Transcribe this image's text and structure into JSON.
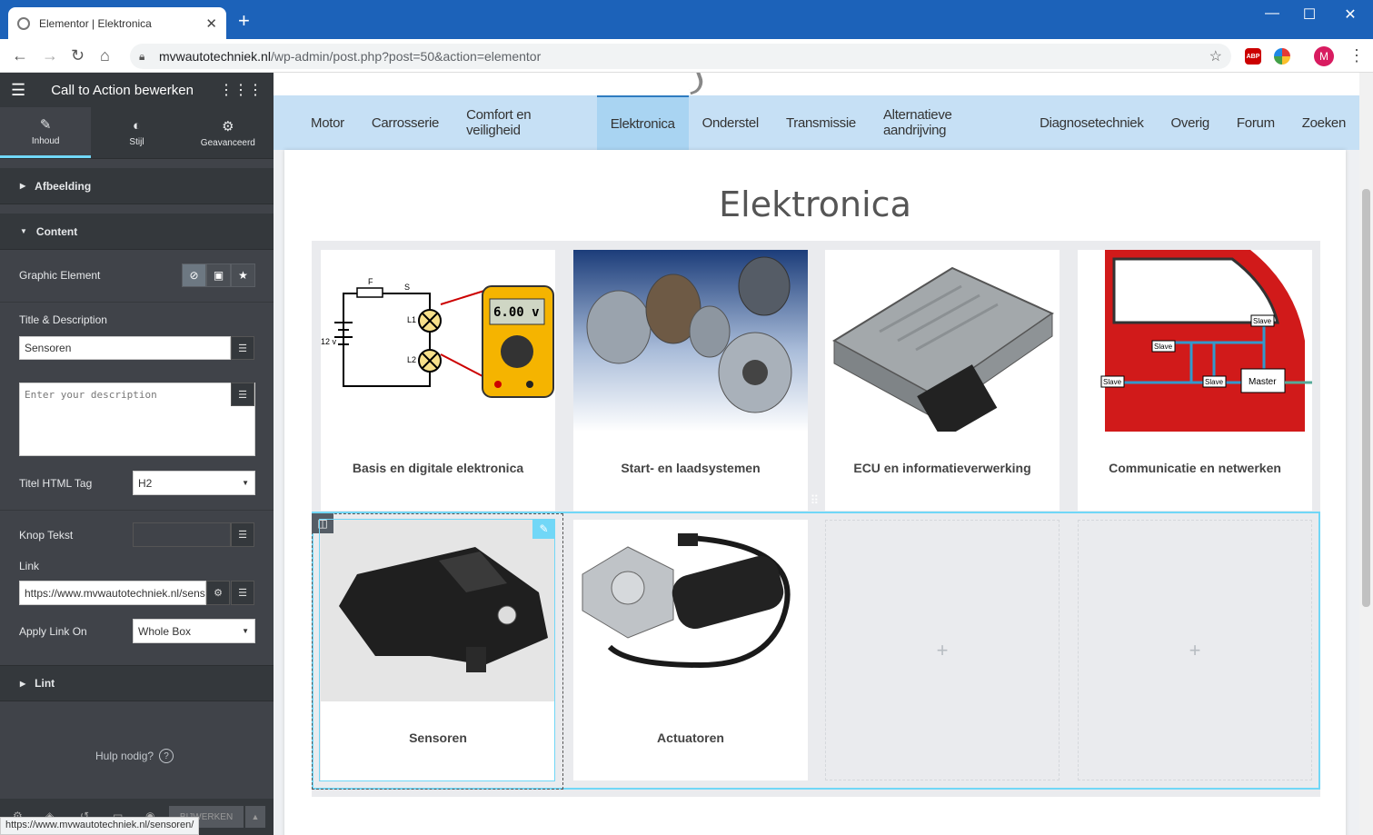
{
  "browser": {
    "tab_title": "Elementor | Elektronica",
    "new_tab": "+",
    "url_domain": "mvwautotechniek.nl",
    "url_path": "/wp-admin/post.php?post=50&action=elementor",
    "avatar_letter": "M",
    "status_url": "https://www.mvwautotechniek.nl/sensoren/",
    "ext_abp": "ABP"
  },
  "panel": {
    "title": "Call to Action bewerken",
    "tabs": [
      {
        "label": "Inhoud",
        "icon": "pencil-icon"
      },
      {
        "label": "Stijl",
        "icon": "contrast-icon"
      },
      {
        "label": "Geavanceerd",
        "icon": "gear-icon"
      }
    ],
    "sections": {
      "afbeelding": "Afbeelding",
      "content": "Content",
      "lint": "Lint"
    },
    "controls": {
      "graphic_element": "Graphic Element",
      "title_desc": "Title & Description",
      "title_value": "Sensoren",
      "desc_placeholder": "Enter your description",
      "html_tag_label": "Titel HTML Tag",
      "html_tag_value": "H2",
      "button_text_label": "Knop Tekst",
      "button_text_value": "",
      "link_label": "Link",
      "link_value": "https://www.mvwautotechniek.nl/sensoren/",
      "apply_link_label": "Apply Link On",
      "apply_link_value": "Whole Box"
    },
    "help": "Hulp nodig?",
    "publish": "BIJWERKEN"
  },
  "site": {
    "menu": [
      "Motor",
      "Carrosserie",
      "Comfort en veiligheid",
      "Elektronica",
      "Onderstel",
      "Transmissie",
      "Alternatieve aandrijving",
      "Diagnosetechniek",
      "Overig",
      "Forum",
      "Zoeken"
    ],
    "active_menu_index": 3,
    "page_title": "Elektronica",
    "cards_row1": [
      "Basis en digitale elektronica",
      "Start- en laadsystemen",
      "ECU en informatieverwerking",
      "Communicatie en netwerken"
    ],
    "cards_row2": [
      "Sensoren",
      "Actuatoren"
    ],
    "multimeter_reading": "6.00 v",
    "circuit_labels": {
      "f": "F",
      "s": "S",
      "v": "12 v",
      "l1": "L1",
      "l2": "L2"
    },
    "network_labels": {
      "slave": "Slave",
      "master": "Master"
    },
    "add": "+"
  },
  "colors": {
    "panel_bg": "#404349",
    "accent": "#71d7f7",
    "menu_bg": "#c6e0f5",
    "menu_active": "#a9d4f2",
    "chrome_bar": "#1c62b9"
  }
}
